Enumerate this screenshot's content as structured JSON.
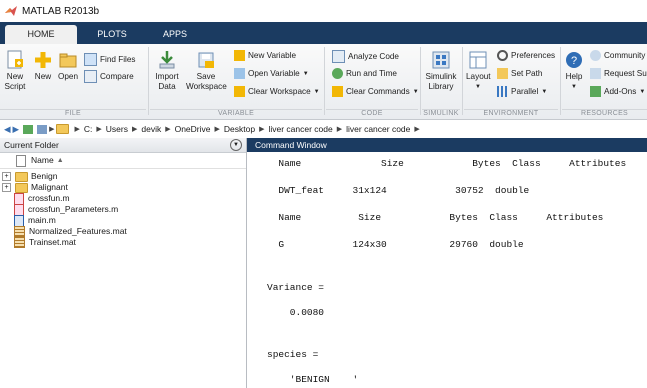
{
  "window": {
    "title": "MATLAB R2013b"
  },
  "tabs": [
    "HOME",
    "PLOTS",
    "APPS"
  ],
  "ribbon": {
    "file": {
      "new_script": "New\nScript",
      "new": "New",
      "open": "Open",
      "find_files": "Find Files",
      "compare": "Compare",
      "label": "FILE"
    },
    "variable": {
      "import_data": "Import\nData",
      "save_workspace": "Save\nWorkspace",
      "new_variable": "New Variable",
      "open_variable": "Open Variable",
      "clear_workspace": "Clear Workspace",
      "label": "VARIABLE"
    },
    "code": {
      "analyze_code": "Analyze Code",
      "run_and_time": "Run and Time",
      "clear_commands": "Clear Commands",
      "label": "CODE"
    },
    "simulink": {
      "library": "Simulink\nLibrary",
      "label": "SIMULINK"
    },
    "environment": {
      "layout": "Layout",
      "preferences": "Preferences",
      "set_path": "Set Path",
      "parallel": "Parallel",
      "label": "ENVIRONMENT"
    },
    "resources": {
      "help": "Help",
      "community": "Community",
      "request_support": "Request Su",
      "add_ons": "Add-Ons",
      "label": "RESOURCES"
    }
  },
  "path": [
    "C:",
    "Users",
    "devik",
    "OneDrive",
    "Desktop",
    "liver cancer code",
    "liver cancer code"
  ],
  "current_folder": {
    "title": "Current Folder",
    "column": "Name",
    "items": [
      {
        "name": "Benign",
        "kind": "folder"
      },
      {
        "name": "Malignant",
        "kind": "folder"
      },
      {
        "name": "crossfun.m",
        "kind": "m"
      },
      {
        "name": "crossfun_Parameters.m",
        "kind": "m"
      },
      {
        "name": "main.m",
        "kind": "m"
      },
      {
        "name": "Normalized_Features.mat",
        "kind": "mat"
      },
      {
        "name": "Trainset.mat",
        "kind": "mat"
      }
    ]
  },
  "command_window": {
    "title": "Command Window",
    "lines": [
      "  Name              Size            Bytes  Class     Attributes",
      "",
      "  DWT_feat     31x124            30752  double",
      "",
      "  Name          Size            Bytes  Class     Attributes",
      "",
      "  G            124x30           29760  double",
      "",
      "",
      "Variance =",
      "",
      "    0.0080",
      "",
      "",
      "species =",
      "",
      "    'BENIGN    '"
    ]
  }
}
